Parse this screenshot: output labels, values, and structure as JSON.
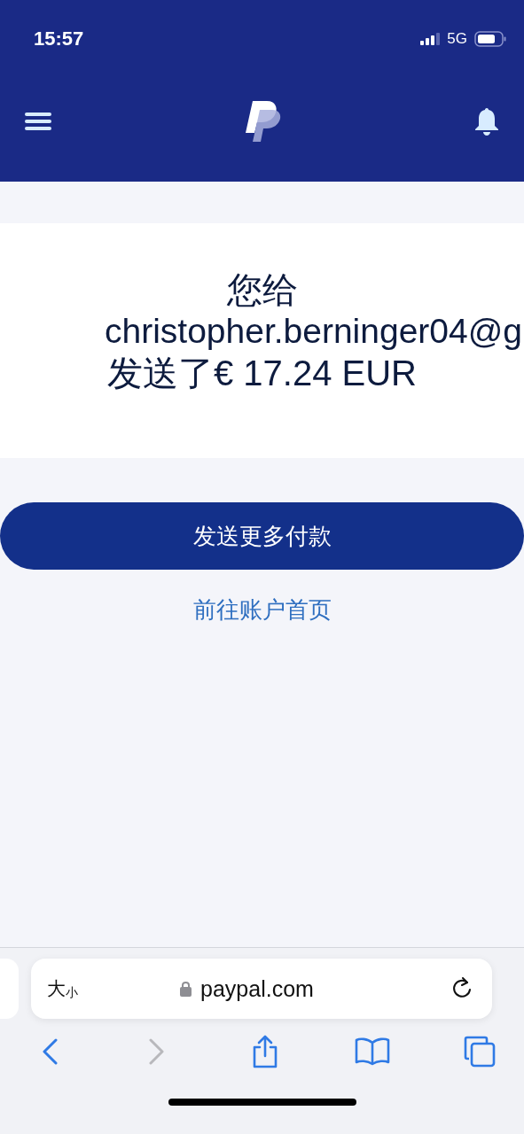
{
  "status_bar": {
    "time": "15:57",
    "network": "5G"
  },
  "message": {
    "line_1": "您给",
    "recipient": "christopher.berninger04@g",
    "line_3": "发送了€ 17.24 EUR"
  },
  "primary_button": "发送更多付款",
  "home_link": "前往账户首页",
  "browser": {
    "text_size_large": "大",
    "text_size_small": "小",
    "url": "paypal.com"
  },
  "toolbar": [
    {
      "kind": "back",
      "disabled": false
    },
    {
      "kind": "forward",
      "disabled": true
    },
    {
      "kind": "share",
      "disabled": false
    },
    {
      "kind": "bookmarks",
      "disabled": false
    },
    {
      "kind": "tabs",
      "disabled": false
    }
  ]
}
